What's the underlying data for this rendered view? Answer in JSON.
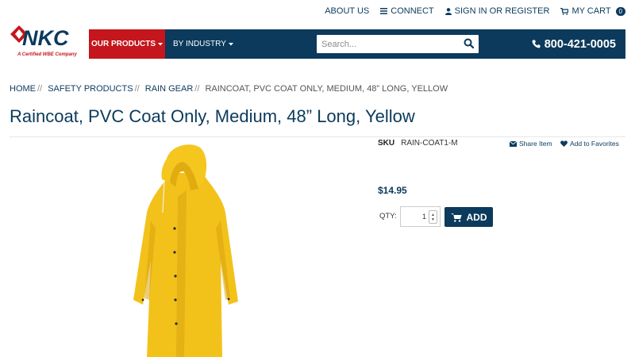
{
  "header": {
    "links": [
      {
        "label": "ABOUT US",
        "icon": ""
      },
      {
        "label": "CONNECT",
        "icon": "menu-icon"
      },
      {
        "label": "SIGN IN OR REGISTER",
        "icon": "user-icon"
      },
      {
        "label": "MY CART",
        "icon": "cart-icon"
      }
    ],
    "cart_count": "0",
    "logo_tagline": "A Certified WBE Company",
    "logo_text": "NKC"
  },
  "nav": {
    "products_label": "OUR PRODUCTS",
    "industry_label": "BY INDUSTRY",
    "search_placeholder": "Search...",
    "phone": "800-421-0005"
  },
  "breadcrumb": {
    "items": [
      "HOME",
      "SAFETY PRODUCTS",
      "RAIN GEAR"
    ],
    "separator": "//",
    "current": "RAINCOAT, PVC COAT ONLY, MEDIUM, 48” LONG, YELLOW"
  },
  "product": {
    "title": "Raincoat, PVC Coat Only, Medium, 48” Long, Yellow",
    "sku_label": "SKU",
    "sku": "RAIN-COAT1-M",
    "share_label": "Share Item",
    "favorites_label": "Add to Favorites",
    "price": "$14.95",
    "qty_label": "QTY:",
    "qty_value": "1",
    "add_label": "ADD"
  },
  "colors": {
    "navy": "#0b3a5c",
    "red": "#c4161c",
    "coat_yellow": "#f2c21a"
  }
}
